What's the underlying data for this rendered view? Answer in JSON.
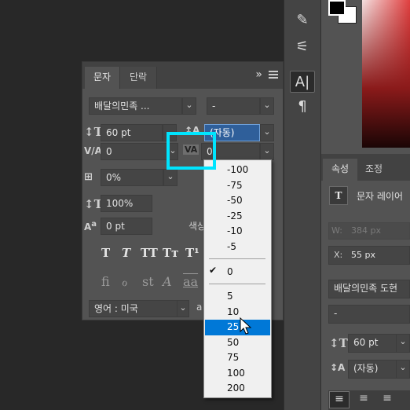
{
  "char_panel": {
    "tabs": [
      "문자",
      "단락"
    ],
    "menu_arrows": "»",
    "font_family": "배달의민족 ...",
    "font_style": "-",
    "font_size": "60 pt",
    "leading": "(자동)",
    "kerning": "0",
    "tracking": "0",
    "scale_percent": "0%",
    "vertical_scale": "100%",
    "baseline_shift": "0 pt",
    "color_label": "색상",
    "style_buttons": [
      "T",
      "T",
      "TT",
      "Tт",
      "T¹"
    ],
    "opentype_buttons": [
      "fi",
      "ℴ",
      "st",
      "A",
      "aa"
    ],
    "language": "영어 : 미국",
    "aa_label": "a"
  },
  "kerning_menu": {
    "options": [
      "-100",
      "-75",
      "-50",
      "-25",
      "-10",
      "-5",
      "0",
      "5",
      "10",
      "25",
      "50",
      "75",
      "100",
      "200"
    ],
    "checked": "0",
    "highlighted": "25"
  },
  "properties_panel": {
    "tabs": [
      "속성",
      "조정"
    ],
    "layer_label": "문자 레이어",
    "w_label": "W:",
    "w_value": "384 px",
    "x_label": "X:",
    "x_value": "55 px",
    "font_family": "배달의민족 도현",
    "font_style": "-",
    "font_size": "60 pt",
    "leading": "(자동)"
  },
  "colors": {
    "highlight": "#00e5ff",
    "selected_option": "#0078d7"
  }
}
